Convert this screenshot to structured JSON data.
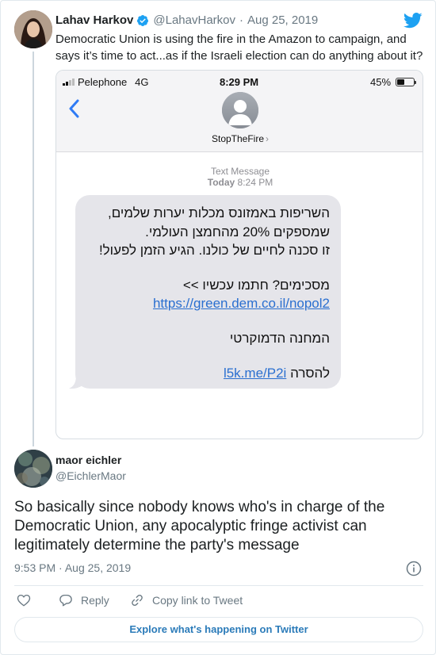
{
  "colors": {
    "link": "#2b7bb9",
    "verified": "#1da1f2",
    "twitter_brand": "#1da1f2",
    "muted": "#697882",
    "imessage_bubble": "#e5e5ea"
  },
  "parent_tweet": {
    "author_name": "Lahav Harkov",
    "handle": "@LahavHarkov",
    "separator": "·",
    "date": "Aug 25, 2019",
    "text": "Democratic Union is using the fire in the Amazon to campaign, and says it’s time to act...as if the Israeli election can do anything about it?",
    "icons": {
      "verified": "verified-badge-icon",
      "brand": "twitter-bird-icon"
    }
  },
  "phone": {
    "carrier": "Pelephone",
    "network": "4G",
    "time": "8:29 PM",
    "battery": "45%",
    "contact_name": "StopTheFire",
    "contact_chevron": "›",
    "message_type": "Text Message",
    "message_day": "Today",
    "message_time": "8:24 PM",
    "message_lines": [
      "השריפות באמזונס מכלות יערות שלמים,",
      "שמספקים 20% מהחמצן העולמי.",
      "זו סכנה לחיים של כולנו. הגיע הזמן לפעול!",
      "מסכימים? חתמו עכשיו >>",
      "https://green.dem.co.il/nopol2",
      "המחנה הדמוקרטי",
      "להסרה",
      "l5k.me/P2i"
    ]
  },
  "reply_tweet": {
    "author_name": "maor eichler",
    "handle": "@EichlerMaor",
    "text": "So basically since nobody knows who's in charge of the Democratic Union, any apocalyptic fringe activist can legitimately determine the party's message",
    "time": "9:53 PM",
    "separator": "·",
    "date": "Aug 25, 2019"
  },
  "actions": {
    "reply_label": "Reply",
    "copy_label": "Copy link to Tweet",
    "explore_label": "Explore what's happening on Twitter"
  }
}
